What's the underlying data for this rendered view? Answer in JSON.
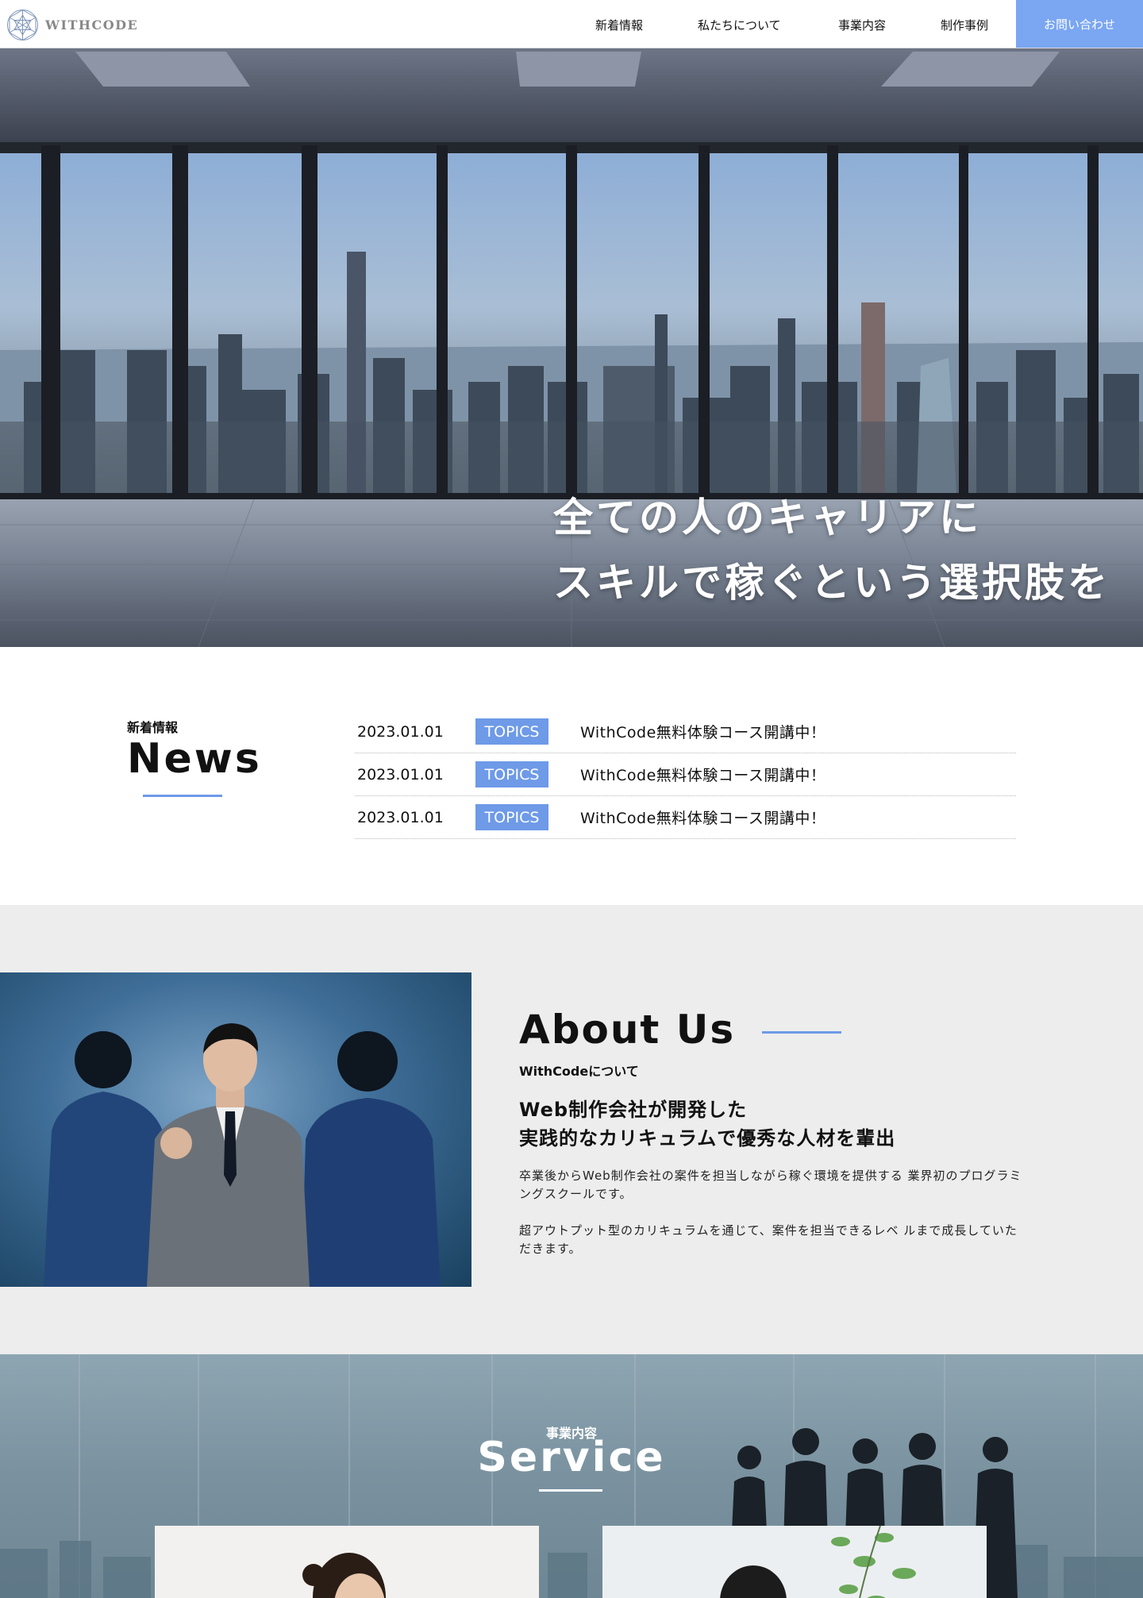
{
  "header": {
    "logo_text": "WITHCODE",
    "nav": [
      "新着情報",
      "私たちについて",
      "事業内容",
      "制作事例"
    ],
    "contact_label": "お問い合わせ"
  },
  "hero": {
    "line1": "全ての人のキャリアに",
    "line2": "スキルで稼ぐという選択肢を"
  },
  "news": {
    "subtitle": "新着情報",
    "title": "News",
    "items": [
      {
        "date": "2023.01.01",
        "tag": "TOPICS",
        "text": "WithCode無料体験コース開講中！"
      },
      {
        "date": "2023.01.01",
        "tag": "TOPICS",
        "text": "WithCode無料体験コース開講中！"
      },
      {
        "date": "2023.01.01",
        "tag": "TOPICS",
        "text": "WithCode無料体験コース開講中！"
      }
    ]
  },
  "about": {
    "title": "About Us",
    "subtitle": "WithCodeについて",
    "lead_line1": "Web制作会社が開発した",
    "lead_line2": "実践的なカリキュラムで優秀な人材を輩出",
    "body1": "卒業後からWeb制作会社の案件を担当しながら稼ぐ環境を提供する 業界初のプログラミングスクールです。",
    "body2": "超アウトプット型のカリキュラムを通じて、案件を担当できるレベ ルまで成長していただきます。"
  },
  "service": {
    "subtitle": "事業内容",
    "title": "Service"
  },
  "colors": {
    "accent": "#6e9ae8",
    "contact_button": "#7aa6f2",
    "about_bg": "#ededed"
  }
}
